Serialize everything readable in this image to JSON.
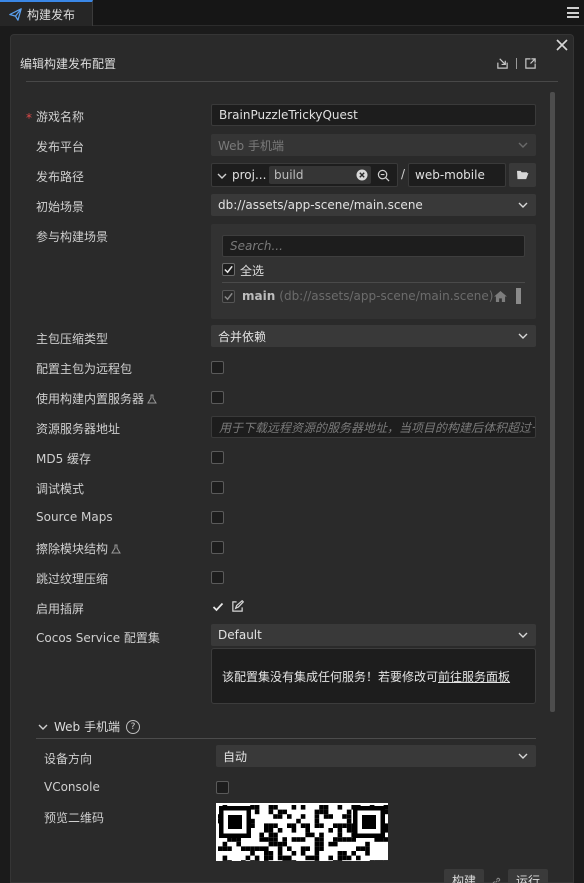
{
  "tab": {
    "title": "构建发布"
  },
  "panel": {
    "title": "编辑构建发布配置"
  },
  "form": {
    "game_name": {
      "label": "游戏名称",
      "required_mark": "*",
      "value": "BrainPuzzleTrickyQuest"
    },
    "platform": {
      "label": "发布平台",
      "value": "Web 手机端"
    },
    "build_path": {
      "label": "发布路径",
      "prefix": "proj...",
      "folder": "build",
      "separator": "/",
      "target": "web-mobile"
    },
    "start_scene": {
      "label": "初始场景",
      "value": "db://assets/app-scene/main.scene"
    },
    "scenes": {
      "label": "参与构建场景",
      "search_placeholder": "Search...",
      "select_all": "全选",
      "items": [
        {
          "name": "main",
          "path": "(db://assets/app-scene/main.scene)"
        }
      ]
    },
    "compression": {
      "label": "主包压缩类型",
      "value": "合并依赖"
    },
    "remote_main": {
      "label": "配置主包为远程包"
    },
    "builtin_server": {
      "label": "使用构建内置服务器"
    },
    "server_address": {
      "label": "资源服务器地址",
      "placeholder": "用于下载远程资源的服务器地址，当项目的构建后体积超过一"
    },
    "md5": {
      "label": "MD5 缓存"
    },
    "debug": {
      "label": "调试模式"
    },
    "source_maps": {
      "label": "Source Maps"
    },
    "erase_modules": {
      "label": "擦除模块结构"
    },
    "skip_texture": {
      "label": "跳过纹理压缩"
    },
    "splash": {
      "label": "启用插屏"
    },
    "cocos_service": {
      "label": "Cocos Service 配置集",
      "value": "Default"
    },
    "service_notice": {
      "text": "该配置集没有集成任何服务！若要修改可",
      "link": "前往服务面板"
    }
  },
  "web_mobile": {
    "section_title": "Web 手机端",
    "help": "?",
    "orientation": {
      "label": "设备方向",
      "value": "自动"
    },
    "vconsole": {
      "label": "VConsole"
    },
    "qrcode": {
      "label": "预览二维码"
    }
  },
  "footer": {
    "build_button": "构建",
    "run_button": "运行"
  },
  "colors": {
    "accent": "#3a87e6",
    "required": "#e04a4a",
    "panel_bg": "#2a2a2a"
  }
}
